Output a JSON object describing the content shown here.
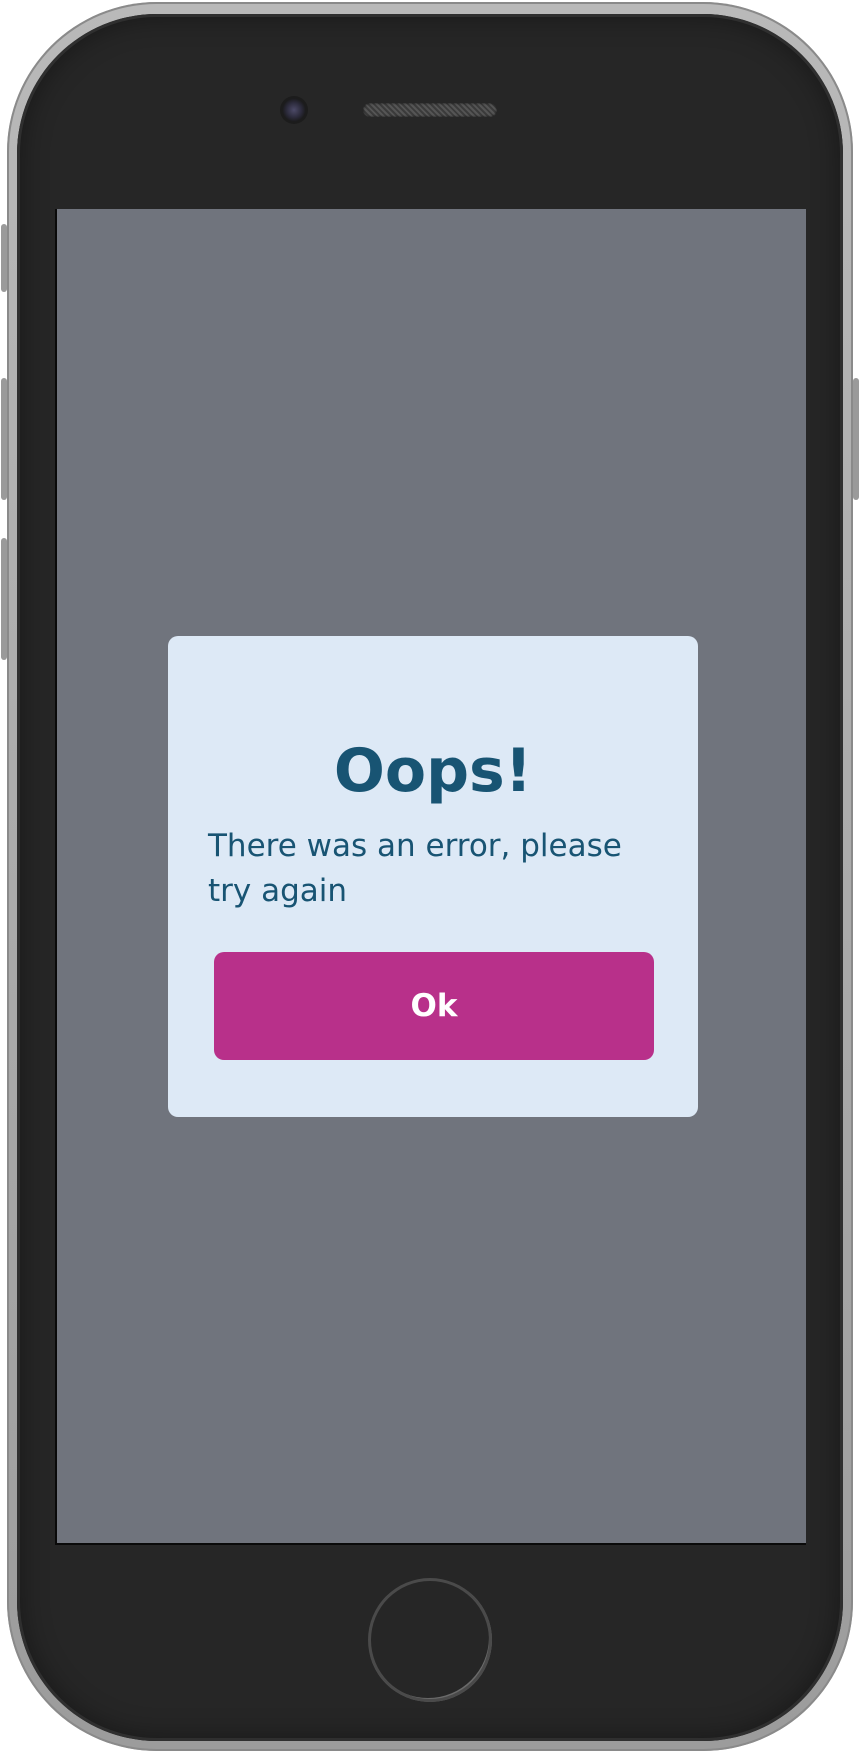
{
  "dialog": {
    "title": "Oops!",
    "message": "There was an error, please try again",
    "ok_label": "Ok"
  },
  "colors": {
    "screen_overlay": "#70747d",
    "dialog_background": "#dde9f6",
    "text": "#185473",
    "button": "#b8308a",
    "button_text": "#ffffff"
  },
  "icons": [
    "front-camera-icon",
    "speaker-grille-icon",
    "home-button-icon"
  ]
}
